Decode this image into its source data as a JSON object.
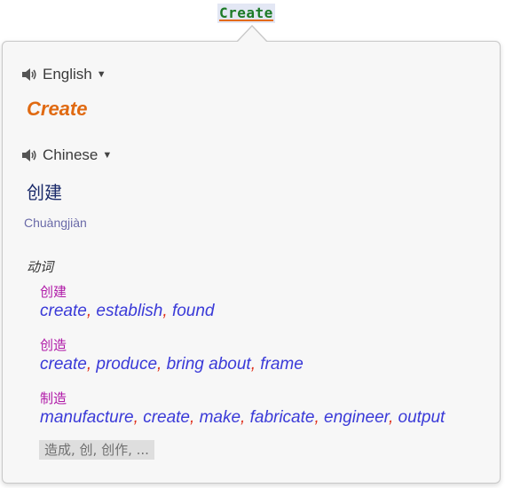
{
  "selection": {
    "text": "Create"
  },
  "source": {
    "language": "English",
    "word": "Create"
  },
  "target": {
    "language": "Chinese",
    "word": "创建",
    "pinyin": "Chuàngjiàn"
  },
  "dictionary": {
    "part_of_speech": "动词",
    "entries": [
      {
        "term": "创建",
        "translations": [
          "create",
          "establish",
          "found"
        ]
      },
      {
        "term": "创造",
        "translations": [
          "create",
          "produce",
          "bring about",
          "frame"
        ]
      },
      {
        "term": "制造",
        "translations": [
          "manufacture",
          "create",
          "make",
          "fabricate",
          "engineer",
          "output"
        ]
      }
    ],
    "more_label": "造成, 创, 创作, ..."
  },
  "icons": {
    "source_speaker": "speaker-icon",
    "target_speaker": "speaker-icon",
    "dropdown": "caret-down-icon"
  },
  "colors": {
    "source_word": "#e06a12",
    "term": "#b01aa8",
    "translation": "#3a3ad8",
    "separator": "#e0301c",
    "selected_word": "#1c7a26"
  }
}
